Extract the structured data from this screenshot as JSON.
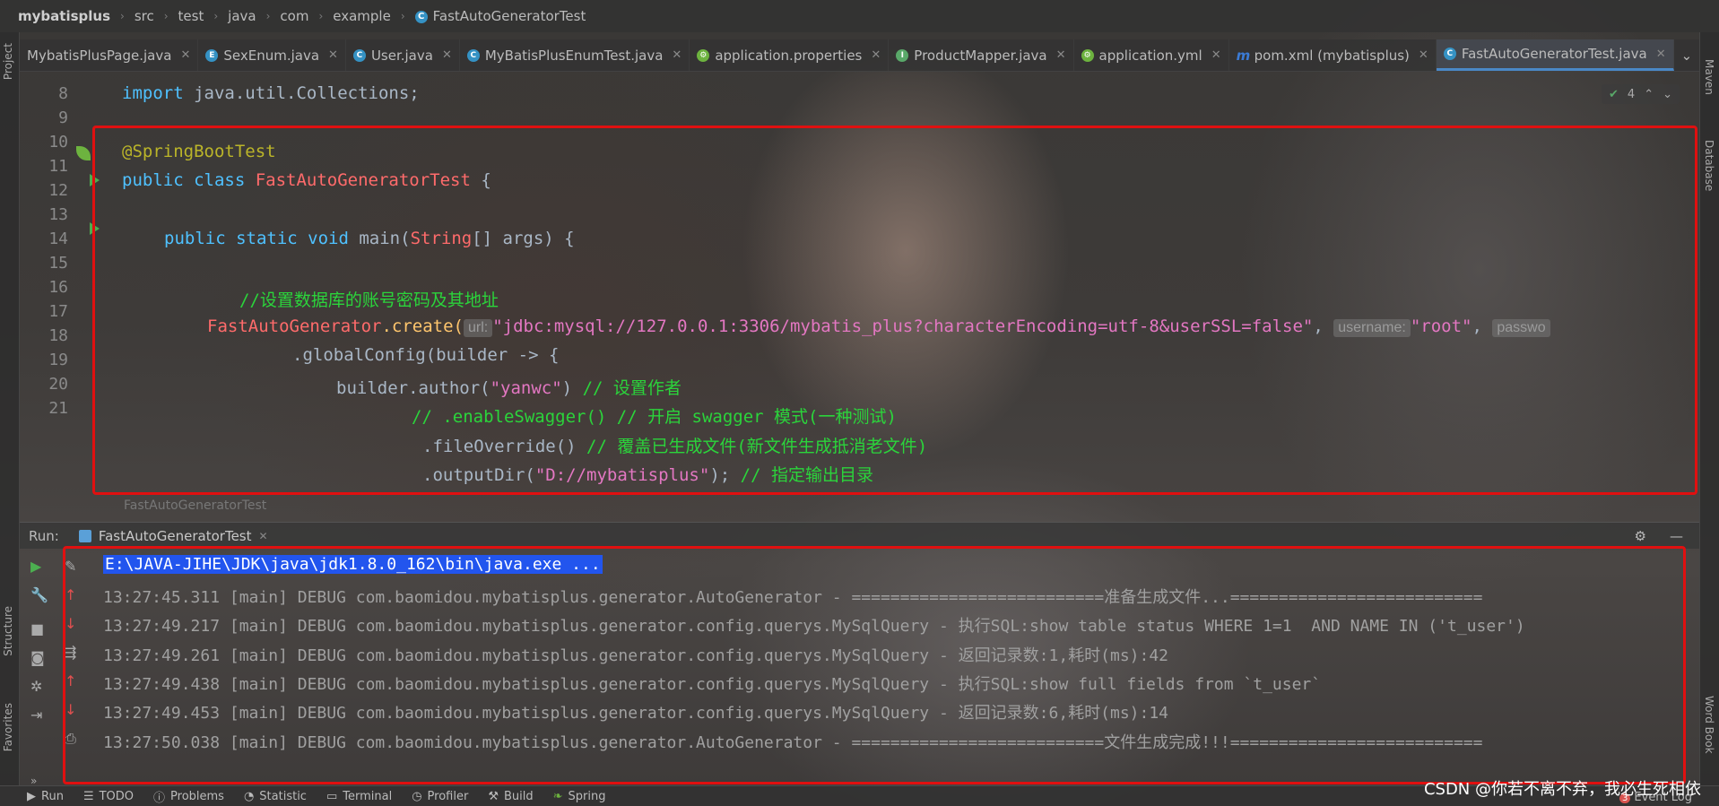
{
  "breadcrumb": [
    "mybatisplus",
    "src",
    "test",
    "java",
    "com",
    "example",
    "FastAutoGeneratorTest"
  ],
  "left_strip": {
    "project": "Project",
    "structure": "Structure",
    "favorites": "Favorites"
  },
  "right_strip": {
    "maven": "Maven",
    "database": "Database",
    "word_book": "Word Book"
  },
  "tabs": [
    {
      "label": "MybatisPlusPage.java",
      "icon": "java-file-icon",
      "color": ""
    },
    {
      "label": "SexEnum.java",
      "icon": "enum-icon",
      "color": "#3592c4"
    },
    {
      "label": "User.java",
      "icon": "class-icon",
      "color": "#3592c4"
    },
    {
      "label": "MyBatisPlusEnumTest.java",
      "icon": "test-class-icon",
      "color": "#3592c4"
    },
    {
      "label": "application.properties",
      "icon": "spring-config-icon",
      "color": "#6db33f"
    },
    {
      "label": "ProductMapper.java",
      "icon": "interface-icon",
      "color": "#59a869"
    },
    {
      "label": "application.yml",
      "icon": "spring-config-icon",
      "color": "#6db33f"
    },
    {
      "label": "pom.xml (mybatisplus)",
      "icon": "maven-icon",
      "color": "#3b7bd5"
    },
    {
      "label": "FastAutoGeneratorTest.java",
      "icon": "test-class-icon",
      "color": "#3592c4",
      "active": true
    }
  ],
  "editor": {
    "inspection_count": "4",
    "line_numbers": [
      "8",
      "9",
      "10",
      "11",
      "12",
      "13",
      "14",
      "15",
      "16",
      "17",
      "18",
      "19",
      "20",
      "21"
    ],
    "lines": {
      "l8_kw": "import",
      "l8_rest": " java.util.Collections;",
      "l10": "@SpringBootTest",
      "l11_kw": "public class",
      "l11_cls": " FastAutoGeneratorTest",
      "l11_rest": " {",
      "l13_kw": "public static void",
      "l13_meth": " main",
      "l13_p1": "(",
      "l13_type": "String",
      "l13_rest": "[] args) {",
      "l15": "//设置数据库的账号密码及其地址",
      "l16_cls": "FastAutoGenerator",
      "l16_create": ".create(",
      "l16_hint_url": "url:",
      "l16_str": "\"jdbc:mysql://127.0.0.1:3306/mybatis_plus?characterEncoding=utf-8&userSSL=false\"",
      "l16_comma": ", ",
      "l16_hint_user": "username:",
      "l16_root": "\"root\"",
      "l16_comma2": ", ",
      "l16_hint_pass": "passwo",
      "l17": ".globalConfig(builder -> {",
      "l18_a": "builder.author(",
      "l18_str": "\"yanwc\"",
      "l18_b": ") ",
      "l18_cmt": "// 设置作者",
      "l19": "// .enableSwagger() // 开启 swagger 模式(一种测试)",
      "l20_a": ".fileOverride() ",
      "l20_cmt": "// 覆盖已生成文件(新文件生成抵消老文件)",
      "l21_a": ".outputDir(",
      "l21_str": "\"D://mybatisplus\"",
      "l21_b": "); ",
      "l21_cmt": "// 指定输出目录"
    },
    "footer": "FastAutoGeneratorTest"
  },
  "run": {
    "title": "Run:",
    "tab": "FastAutoGeneratorTest",
    "console": [
      "E:\\JAVA-JIHE\\JDK\\java\\jdk1.8.0_162\\bin\\java.exe ...",
      "13:27:45.311 [main] DEBUG com.baomidou.mybatisplus.generator.AutoGenerator - ==========================准备生成文件...==========================",
      "13:27:49.217 [main] DEBUG com.baomidou.mybatisplus.generator.config.querys.MySqlQuery - 执行SQL:show table status WHERE 1=1  AND NAME IN ('t_user')",
      "13:27:49.261 [main] DEBUG com.baomidou.mybatisplus.generator.config.querys.MySqlQuery - 返回记录数:1,耗时(ms):42",
      "13:27:49.438 [main] DEBUG com.baomidou.mybatisplus.generator.config.querys.MySqlQuery - 执行SQL:show full fields from `t_user`",
      "13:27:49.453 [main] DEBUG com.baomidou.mybatisplus.generator.config.querys.MySqlQuery - 返回记录数:6,耗时(ms):14",
      "13:27:50.038 [main] DEBUG com.baomidou.mybatisplus.generator.AutoGenerator - ==========================文件生成完成!!!=========================="
    ]
  },
  "statusbar": {
    "items": [
      "Run",
      "TODO",
      "Problems",
      "Statistic",
      "Terminal",
      "Profiler",
      "Build",
      "Spring"
    ],
    "event_log": "Event Log",
    "event_count": "3"
  },
  "watermark": "CSDN @你若不离不弃，我必生死相依",
  "colors": {
    "highlight_box": "#e01010",
    "selection": "#2255ee",
    "accent": "#4a88c7"
  }
}
